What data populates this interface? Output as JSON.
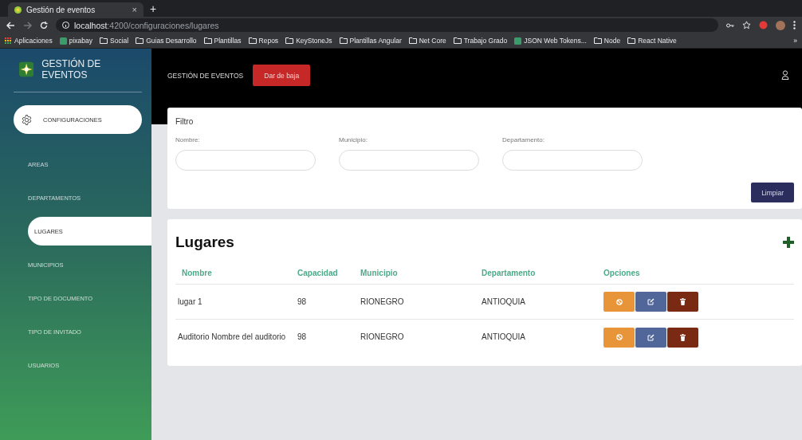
{
  "browser": {
    "tab_title": "Gestión de eventos",
    "tab_close": "×",
    "new_tab": "+",
    "url_host": "localhost",
    "url_path": ":4200/configuraciones/lugares",
    "bookmarks": [
      {
        "label": "Aplicaciones",
        "kind": "apps"
      },
      {
        "label": "pixabay",
        "kind": "site"
      },
      {
        "label": "Social",
        "kind": "folder"
      },
      {
        "label": "Guias Desarrollo",
        "kind": "folder"
      },
      {
        "label": "Plantillas",
        "kind": "folder"
      },
      {
        "label": "Repos",
        "kind": "folder"
      },
      {
        "label": "KeyStoneJs",
        "kind": "folder"
      },
      {
        "label": "Plantillas Angular",
        "kind": "folder"
      },
      {
        "label": "Net Core",
        "kind": "folder"
      },
      {
        "label": "Trabajo Grado",
        "kind": "folder"
      },
      {
        "label": "JSON Web Tokens...",
        "kind": "site"
      },
      {
        "label": "Node",
        "kind": "folder"
      },
      {
        "label": "React Native",
        "kind": "folder"
      }
    ],
    "more": "»"
  },
  "sidebar": {
    "brand": "GESTIÓN DE EVENTOS",
    "section": {
      "label": "CONFIGURACIONES",
      "selected": true
    },
    "items": [
      {
        "label": "AREAS",
        "selected": false
      },
      {
        "label": "DEPARTAMENTOS",
        "selected": false
      },
      {
        "label": "LUGARES",
        "selected": true
      },
      {
        "label": "MUNICIPIOS",
        "selected": false
      },
      {
        "label": "TIPO DE DOCUMENTO",
        "selected": false
      },
      {
        "label": "TIPO DE INVITADO",
        "selected": false
      },
      {
        "label": "USUARIOS",
        "selected": false
      }
    ]
  },
  "header": {
    "title": "GESTIÓN DE EVENTOS",
    "logout_button": "Dar de baja"
  },
  "filter": {
    "title": "Filtro",
    "fields": [
      {
        "label": "Nombre:"
      },
      {
        "label": "Municipio:"
      },
      {
        "label": "Departamento:"
      }
    ],
    "clear_button": "Limpiar"
  },
  "table": {
    "title": "Lugares",
    "columns": [
      "Nombre",
      "Capacidad",
      "Municipio",
      "Departamento",
      "Opciones"
    ],
    "rows": [
      {
        "cells": [
          "lugar 1",
          "98",
          "RIONEGRO",
          "ANTIOQUIA"
        ]
      },
      {
        "cells": [
          "Auditorio Nombre del auditorio",
          "98",
          "RIONEGRO",
          "ANTIOQUIA"
        ]
      }
    ]
  }
}
